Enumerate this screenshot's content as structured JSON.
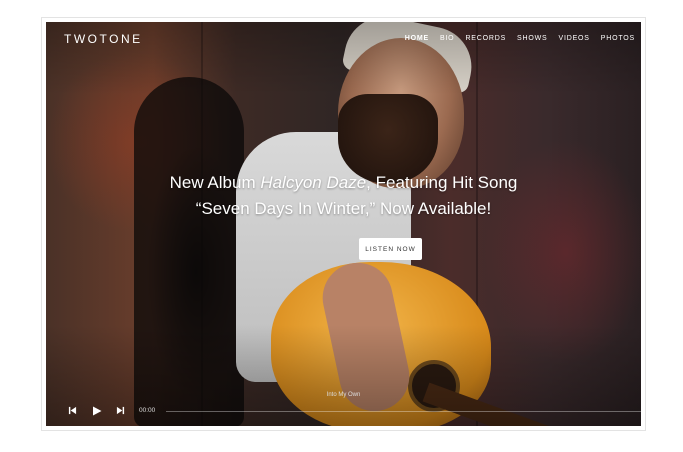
{
  "site": {
    "logo": "TWOTONE"
  },
  "nav": {
    "items": [
      {
        "label": "HOME",
        "active": true
      },
      {
        "label": "BIO",
        "active": false
      },
      {
        "label": "RECORDS",
        "active": false
      },
      {
        "label": "SHOWS",
        "active": false
      },
      {
        "label": "VIDEOS",
        "active": false
      },
      {
        "label": "PHOTOS",
        "active": false
      }
    ]
  },
  "hero": {
    "headline_part1": "New Album ",
    "headline_album": "Halcyon Daze",
    "headline_part2": ", Featuring Hit Song",
    "headline_line2": "“Seven Days In Winter,” Now Available!",
    "cta_label": "LISTEN NOW"
  },
  "player": {
    "track_title": "Into My Own",
    "time": "00:00",
    "progress": 0,
    "icons": [
      "previous-icon",
      "play-icon",
      "next-icon"
    ]
  },
  "colors": {
    "text": "#ffffff",
    "cta_background": "#ffffff",
    "cta_text": "#333333"
  }
}
